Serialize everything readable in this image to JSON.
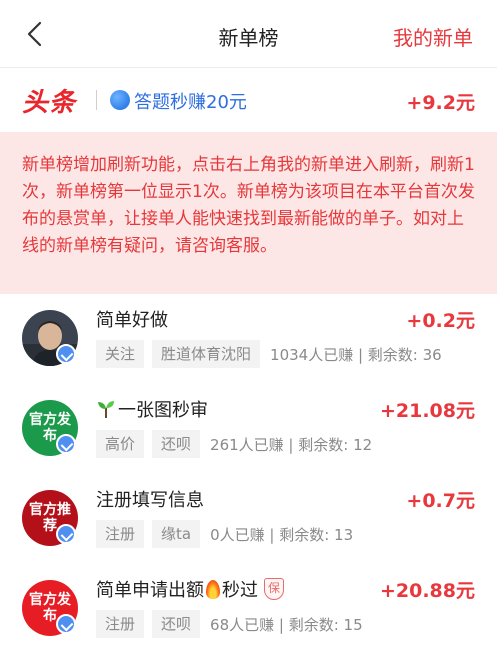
{
  "nav": {
    "back_icon": "chevron-left-icon",
    "title": "新单榜",
    "my_orders": "我的新单"
  },
  "featured": {
    "logo_text": "头条",
    "title": "答题秒赚20元",
    "reward": "+9.2元"
  },
  "notice": {
    "text": "新单榜增加刷新功能，点击右上角我的新单进入刷新，刷新1次，新单榜第一位显示1次。新单榜为该项目在本平台首次发布的悬赏单，让接单人能快速找到最新能做的单子。如对上线的新单榜有疑问，请咨询客服。"
  },
  "tasks": [
    {
      "name": "简单好做",
      "reward": "+0.2元",
      "tags": [
        "关注",
        "胜道体育沈阳"
      ],
      "stats": "1034人已赚 | 剩余数: 36"
    },
    {
      "name": "一张图秒审",
      "reward": "+21.08元",
      "tags": [
        "高价",
        "还呗"
      ],
      "stats": "261人已赚 | 剩余数: 12",
      "avatar_text": "官方发布",
      "prefix_icon": "sprout-icon"
    },
    {
      "name": "注册填写信息",
      "reward": "+0.7元",
      "tags": [
        "注册",
        "缘ta"
      ],
      "stats": "0人已赚 | 剩余数: 13",
      "avatar_text": "官方推荐"
    },
    {
      "name_part1": "简单申请出额",
      "name_part2": "秒过",
      "badge": "保",
      "reward": "+20.88元",
      "tags": [
        "注册",
        "还呗"
      ],
      "stats": "68人已赚 | 剩余数: 15",
      "avatar_text": "官方发布"
    }
  ],
  "colors": {
    "accent": "#e8383d",
    "notice_bg": "#fde6e6",
    "link_blue": "#2e6ee0"
  }
}
